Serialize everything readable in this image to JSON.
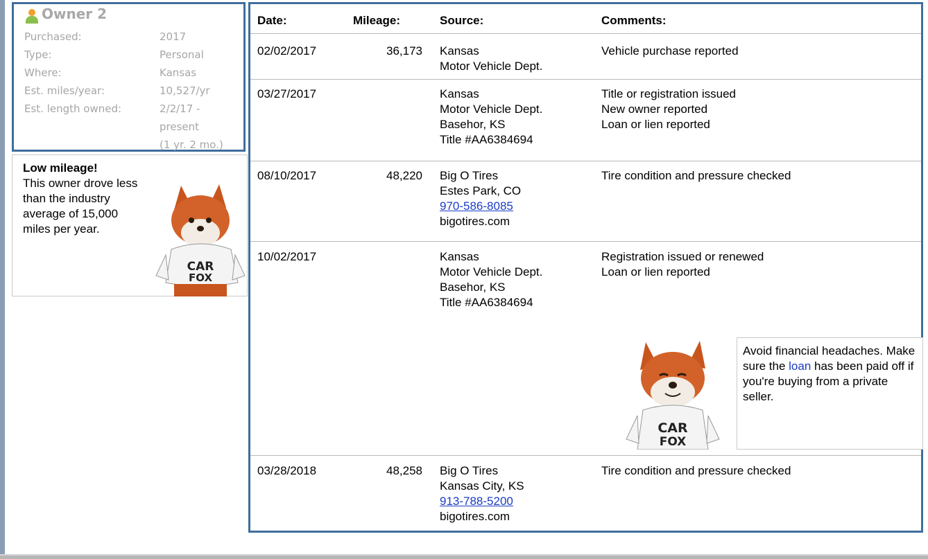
{
  "owner": {
    "title": "Owner 2",
    "rows": [
      {
        "label": "Purchased:",
        "value": "2017"
      },
      {
        "label": "Type:",
        "value": "Personal"
      },
      {
        "label": "Where:",
        "value": "Kansas"
      },
      {
        "label": "Est. miles/year:",
        "value": "10,527/yr"
      },
      {
        "label": "Est. length owned:",
        "value": "2/2/17 -"
      },
      {
        "label": "",
        "value": "present"
      },
      {
        "label": "",
        "value": "(1 yr. 2 mo.)"
      }
    ]
  },
  "low_mileage": {
    "title": "Low mileage!",
    "body": "This owner drove less than the industry average of 15,000 miles per year."
  },
  "table": {
    "headers": {
      "date": "Date:",
      "mileage": "Mileage:",
      "source": "Source:",
      "comments": "Comments:"
    },
    "rows": [
      {
        "date": "02/02/2017",
        "mileage": "36,173",
        "source": [
          "Kansas",
          "Motor Vehicle Dept."
        ],
        "comments": [
          "Vehicle purchase reported"
        ]
      },
      {
        "date": "03/27/2017",
        "mileage": "",
        "source": [
          "Kansas",
          "Motor Vehicle Dept.",
          "Basehor, KS",
          "Title #AA6384694"
        ],
        "comments": [
          "Title or registration issued",
          "New owner reported",
          "Loan or lien reported"
        ]
      },
      {
        "date": "08/10/2017",
        "mileage": "48,220",
        "source": [
          "Big O Tires",
          "Estes Park, CO"
        ],
        "phone": "970-586-8085",
        "site": "bigotires.com",
        "comments": [
          "Tire condition and pressure checked"
        ]
      },
      {
        "date": "10/02/2017",
        "mileage": "",
        "source": [
          "Kansas",
          "Motor Vehicle Dept.",
          "Basehor, KS",
          "Title #AA6384694"
        ],
        "comments": [
          "Registration issued or renewed",
          "Loan or lien reported"
        ]
      },
      {
        "date": "03/28/2018",
        "mileage": "48,258",
        "source": [
          "Big O Tires",
          "Kansas City, KS"
        ],
        "phone": "913-788-5200",
        "site": "bigotires.com",
        "comments": [
          "Tire condition and pressure checked"
        ]
      }
    ]
  },
  "tip": {
    "before": "Avoid financial headaches. Make sure the ",
    "link": "loan",
    "after": " has been paid off if you're buying from a private seller."
  },
  "mascot_text": "CAR FOX",
  "colors": {
    "frame": "#3f6e9c",
    "link": "#1a3cc6",
    "muted": "#a6a6a6"
  }
}
